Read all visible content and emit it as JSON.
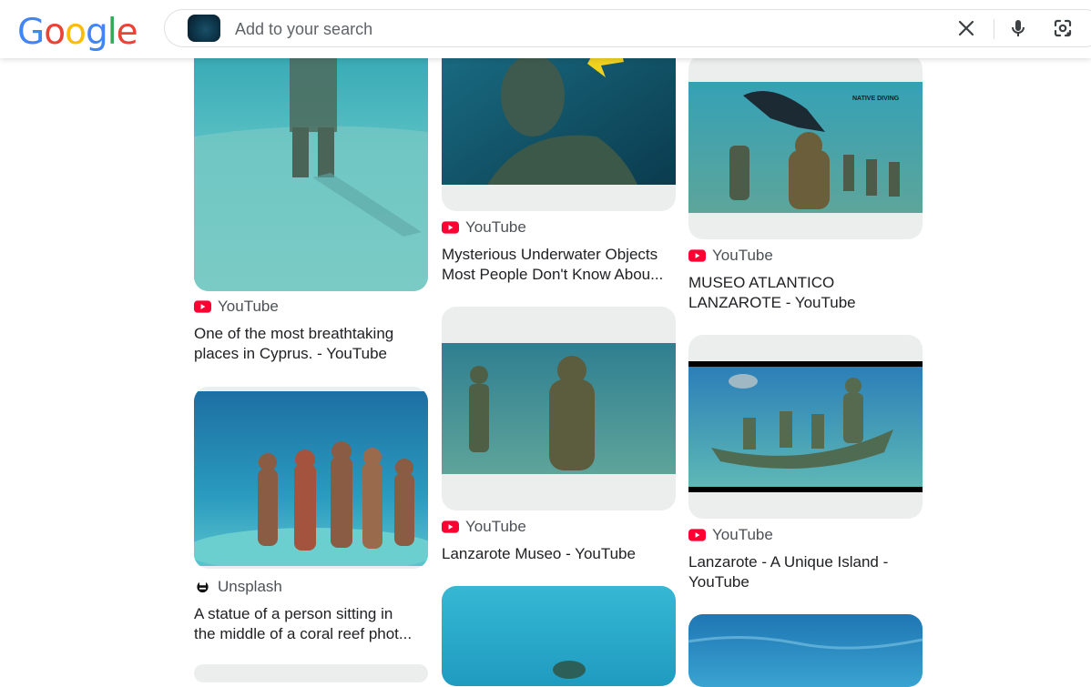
{
  "header": {
    "logo_text": "Google",
    "logo_colors": [
      "#4285F4",
      "#EA4335",
      "#FBBC05",
      "#4285F4",
      "#34A853",
      "#EA4335"
    ],
    "search_placeholder": "Add to your search",
    "icons": [
      "close-icon",
      "microphone-icon",
      "lens-icon"
    ]
  },
  "results": [
    {
      "source": "YouTube",
      "source_icon": "youtube-icon",
      "title_line1": "One of the most breathtaking",
      "title_line2": "places in Cyprus. - YouTube"
    },
    {
      "source": "Unsplash",
      "source_icon": "unsplash-icon",
      "title_line1": "A statue of a person sitting in",
      "title_line2": "the middle of a coral reef phot..."
    },
    {
      "source": "YouTube",
      "source_icon": "youtube-icon",
      "title_line1": "Mysterious Underwater Objects",
      "title_line2": "Most People Don't Know Abou..."
    },
    {
      "source": "YouTube",
      "source_icon": "youtube-icon",
      "title_line1": "Lanzarote Museo - YouTube",
      "title_line2": ""
    },
    {
      "source": "YouTube",
      "source_icon": "youtube-icon",
      "title_line1": "MUSEO ATLANTICO",
      "title_line2": "LANZAROTE - YouTube"
    },
    {
      "source": "YouTube",
      "source_icon": "youtube-icon",
      "title_line1": "Lanzarote - A Unique Island -",
      "title_line2": "YouTube"
    }
  ],
  "image_watermark": "NATIVE DIVING"
}
